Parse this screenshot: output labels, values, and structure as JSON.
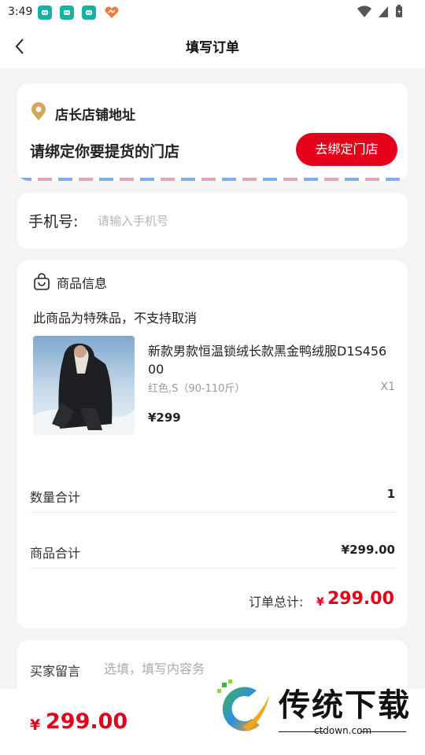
{
  "status_bar": {
    "time": "3:49"
  },
  "header": {
    "title": "填写订单"
  },
  "store": {
    "title": "店长店铺地址",
    "prompt": "请绑定你要提货的门店",
    "bind_button": "去绑定门店"
  },
  "phone": {
    "label": "手机号:",
    "placeholder": "请输入手机号"
  },
  "goods": {
    "section_title": "商品信息",
    "notice": "此商品为特殊品，不支持取消",
    "item": {
      "name": "新款男款恒温锁绒长款黑金鸭绒服D1S45600",
      "spec": "红色,S（90-110斤）",
      "quantity": "X1",
      "price": "¥299"
    },
    "summary": {
      "qty_label": "数量合计",
      "qty_value": "1",
      "subtotal_label": "商品合计",
      "subtotal_value": "¥299.00",
      "total_label": "订单总计:",
      "total_currency": "¥",
      "total_value": "299.00"
    }
  },
  "remark": {
    "label": "买家留言",
    "placeholder": "选填，填写内容务"
  },
  "bottom_bar": {
    "currency": "¥",
    "total": "299.00"
  },
  "watermark": {
    "text": "传统下载",
    "url": "ctdown.com"
  },
  "colors": {
    "accent": "#e4001b",
    "background": "#f4f4f4",
    "pin": "#d6a35a"
  }
}
